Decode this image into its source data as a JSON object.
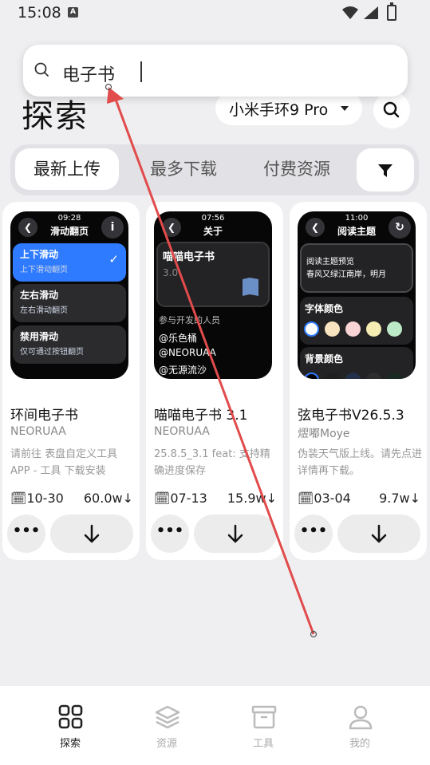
{
  "status_bar": {
    "time": "15:08",
    "notification_icon": "A"
  },
  "search": {
    "query": "电子书"
  },
  "header": {
    "title": "探索",
    "device": "小米手环9 Pro"
  },
  "tabs": [
    {
      "label": "最新上传",
      "active": true
    },
    {
      "label": "最多下载",
      "active": false
    },
    {
      "label": "付费资源",
      "active": false
    }
  ],
  "cards": [
    {
      "title": "环间电子书",
      "author": "NEORUAA",
      "description": "请前往 表盘自定义工具 APP - 工具 下载安装",
      "date": "10-30",
      "size": "60.0w",
      "more_label": "•••",
      "preview": {
        "time": "09:28",
        "title": "滑动翻页",
        "corner": "i",
        "options": [
          {
            "label": "上下滑动",
            "sub": "上下滑动翻页",
            "selected": true
          },
          {
            "label": "左右滑动",
            "sub": "左右滑动翻页",
            "selected": false
          },
          {
            "label": "禁用滑动",
            "sub": "仅可通过按钮翻页",
            "selected": false
          }
        ]
      }
    },
    {
      "title": "喵喵电子书 3.1",
      "author": "NEORUAA",
      "description": "25.8.5_3.1 feat: 支持精确进度保存",
      "date": "07-13",
      "size": "15.9w",
      "more_label": "•••",
      "preview": {
        "time": "07:56",
        "title": "关于",
        "app_name": "喵喵电子书",
        "version": "3.0",
        "section": "参与开发的人员",
        "people": [
          "@乐色桶",
          "@NEORUAA",
          "@无源流沙"
        ]
      }
    },
    {
      "title": "弦电子书V26.5.3",
      "author": "熤嘟Moye",
      "description": "伪装天气版上线。请先点进详情再下载。",
      "date": "03-04",
      "size": "9.7w",
      "more_label": "•••",
      "preview": {
        "time": "11:00",
        "title": "阅读主题",
        "box_title": "阅读主题预览",
        "box_text": "春风又绿江南岸，明月",
        "font_color_label": "字体颜色",
        "font_colors": [
          "#ffffff",
          "#f7e3bf",
          "#f9d4d6",
          "#f4ecb3",
          "#bdeac6"
        ],
        "bg_color_label": "背景颜色",
        "bg_colors": [
          "#000000",
          "#1f1f22",
          "#24304a",
          "#2d2d2d",
          "#1a2a22"
        ]
      }
    }
  ],
  "bottom_nav": [
    {
      "label": "探索",
      "icon": "explore-grid-icon",
      "active": true
    },
    {
      "label": "资源",
      "icon": "layers-icon",
      "active": false
    },
    {
      "label": "工具",
      "icon": "toolbox-icon",
      "active": false
    },
    {
      "label": "我的",
      "icon": "person-icon",
      "active": false
    }
  ]
}
